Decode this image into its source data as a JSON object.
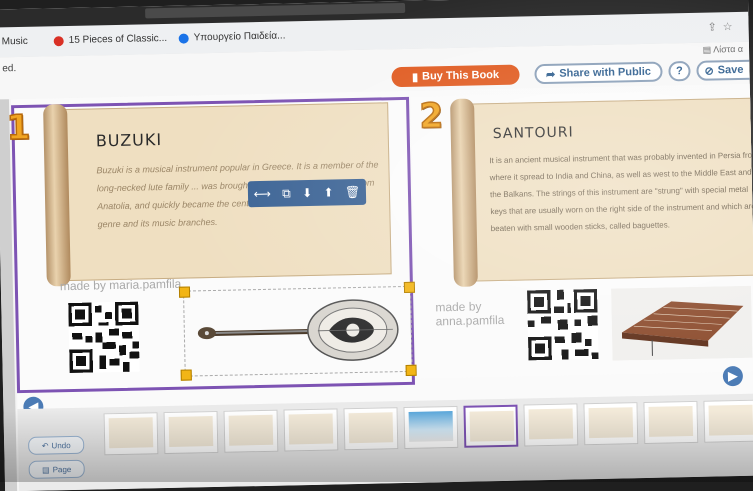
{
  "browser": {
    "bookmarks": [
      {
        "label": "Music",
        "color": "#888888"
      },
      {
        "label": "15 Pieces of Classic...",
        "color": "#d93025"
      },
      {
        "label": "Υπουργείο Παιδεία...",
        "color": "#1a73e8"
      }
    ],
    "list_label": "Λίστα α"
  },
  "app": {
    "edited_label": "ed.",
    "buy_label": "Buy This Book",
    "share_label": "Share with Public",
    "help_label": "?",
    "save_label": "Save"
  },
  "pages": [
    {
      "number": "1",
      "title": "BUZUKI",
      "text": "Buzuki is a musical instrument popular in Greece. It is a member of the long-necked lute family ... was brought to Greece in the early 1... from Anatolia, and quickly became the central instrument to the rebetiko genre and its music branches.",
      "made_by": "made by maria.pamfila",
      "instrument_icon": "bouzouki-image"
    },
    {
      "number": "2",
      "title": "SANTOURI",
      "text": "It is an ancient musical instrument that was probably invented in Persia from where it spread to India and China, as well as west to the Middle East and the Balkans. The strings of this instrument are \"strung\" with special metal keys that are usually worn on the right side of the instrument and which are beaten with small wooden sticks, called baguettes.",
      "made_by_line1": "made by",
      "made_by_line2": "anna.pamfila",
      "instrument_icon": "santouri-image"
    }
  ],
  "editor": {
    "toolbar_icons": [
      "resize-icon",
      "duplicate-icon",
      "move-down-icon",
      "move-up-icon",
      "delete-icon"
    ]
  },
  "bottom": {
    "undo_label": "Undo",
    "page_label": "Page",
    "thumbnail_count": 11
  }
}
